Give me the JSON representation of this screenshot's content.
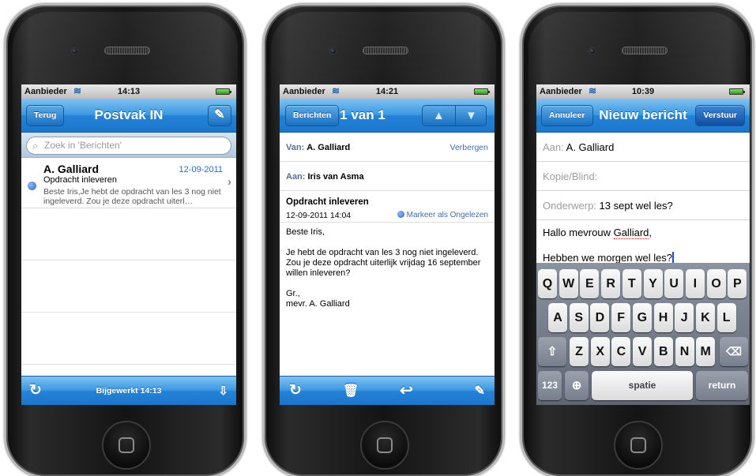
{
  "phone1": {
    "status": {
      "carrier": "Aanbieder",
      "time": "14:13"
    },
    "nav": {
      "back_label": "Terug",
      "title": "Postvak IN"
    },
    "search": {
      "placeholder": "Zoek in 'Berichten'"
    },
    "messages": [
      {
        "from": "A. Galliard",
        "date": "12-09-2011",
        "subject": "Opdracht inleveren",
        "preview": "Beste Iris,Je hebt de opdracht van les 3 nog niet ingeleverd. Zou je deze opdracht uiterl…",
        "unread": true
      }
    ],
    "toolbar": {
      "updated": "Bijgewerkt 14:13"
    }
  },
  "phone2": {
    "status": {
      "carrier": "Aanbieder",
      "time": "14:21"
    },
    "nav": {
      "back_label": "Berichten",
      "title": "1 van 1"
    },
    "header": {
      "from_label": "Van:",
      "from_value": "A. Galliard",
      "hide_label": "Verbergen",
      "to_label": "Aan:",
      "to_value": "Iris van Asma"
    },
    "subject": "Opdracht inleveren",
    "timestamp": "12-09-2011 14:04",
    "mark_unread": "Markeer als Ongelezen",
    "body": {
      "greeting": "Beste Iris,",
      "text": "Je hebt de opdracht van les 3 nog niet ingeleverd. Zou je deze opdracht uiterlijk vrijdag 16 september willen inleveren?",
      "closing": "Gr.,",
      "signature": "mevr. A. Galliard"
    }
  },
  "phone3": {
    "status": {
      "carrier": "Aanbieder",
      "time": "10:39"
    },
    "nav": {
      "cancel_label": "Annuleer",
      "title": "Nieuw bericht",
      "send_label": "Verstuur"
    },
    "to": {
      "label": "Aan:",
      "value": "A. Galliard"
    },
    "cc": {
      "label": "Kopie/Blind:"
    },
    "subject": {
      "label": "Onderwerp:",
      "value": "13 sept wel les?"
    },
    "body": {
      "line1_pre": "Hallo mevrouw ",
      "line1_word": "Galliard",
      "line1_post": ",",
      "line2": "Hebben we morgen wel les?"
    },
    "keyboard": {
      "row1": [
        "Q",
        "W",
        "E",
        "R",
        "T",
        "Y",
        "U",
        "I",
        "O",
        "P"
      ],
      "row2": [
        "A",
        "S",
        "D",
        "F",
        "G",
        "H",
        "J",
        "K",
        "L"
      ],
      "row3": [
        "Z",
        "X",
        "C",
        "V",
        "B",
        "N",
        "M"
      ],
      "numbers": "123",
      "space": "spatie",
      "return": "return"
    }
  },
  "colors": {
    "ios_blue": "#2483d6",
    "unread_dot": "#2d68c9",
    "link": "#3f6fae"
  }
}
